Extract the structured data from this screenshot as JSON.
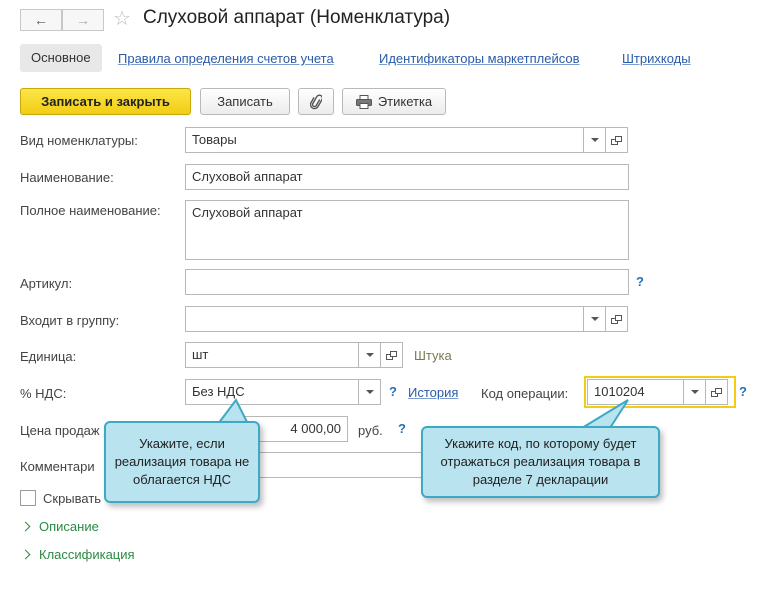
{
  "window": {
    "title": "Слуховой аппарат (Номенклатура)"
  },
  "nav": {
    "back_icon": "arrow-left-icon",
    "forward_icon": "arrow-right-icon",
    "favorite_icon": "star-icon"
  },
  "tabs": [
    {
      "label": "Основное",
      "active": true
    },
    {
      "label": "Правила определения счетов учета",
      "active": false
    },
    {
      "label": "Идентификаторы маркетплейсов",
      "active": false
    },
    {
      "label": "Штрихкоды",
      "active": false
    }
  ],
  "toolbar": {
    "save_close_label": "Записать и закрыть",
    "save_label": "Записать",
    "attach_icon": "paperclip-icon",
    "label_button": "Этикетка",
    "print_icon": "printer-icon"
  },
  "form": {
    "kind": {
      "label": "Вид номенклатуры:",
      "value": "Товары"
    },
    "name": {
      "label": "Наименование:",
      "value": "Слуховой аппарат"
    },
    "full_name": {
      "label": "Полное наименование:",
      "value": "Слуховой аппарат"
    },
    "article": {
      "label": "Артикул:",
      "value": "",
      "help": "?"
    },
    "group": {
      "label": "Входит в группу:",
      "value": ""
    },
    "unit": {
      "label": "Единица:",
      "value": "шт",
      "hint": "Штука"
    },
    "vat": {
      "label": "% НДС:",
      "value": "Без НДС",
      "help": "?",
      "history_link": "История"
    },
    "op_code": {
      "label": "Код операции:",
      "value": "1010204",
      "help": "?"
    },
    "price": {
      "label": "Цена продаж",
      "value": "4 000,00",
      "currency": "руб.",
      "help": "?"
    },
    "comment": {
      "label": "Комментари"
    },
    "hide": {
      "label": "Скрывать"
    }
  },
  "sections": [
    {
      "label": "Описание"
    },
    {
      "label": "Классификация"
    }
  ],
  "callouts": {
    "vat": "Укажите, если реализация товара не облагается НДС",
    "op_code": "Укажите код, по которому будет отражаться реализация товара в разделе 7 декларации"
  },
  "colors": {
    "accent_link": "#2b5ba8",
    "primary_button": "#f2cd14",
    "callout_bg": "#b9e3ee",
    "callout_border": "#3ea9c4",
    "section_green": "#2b8a42"
  }
}
